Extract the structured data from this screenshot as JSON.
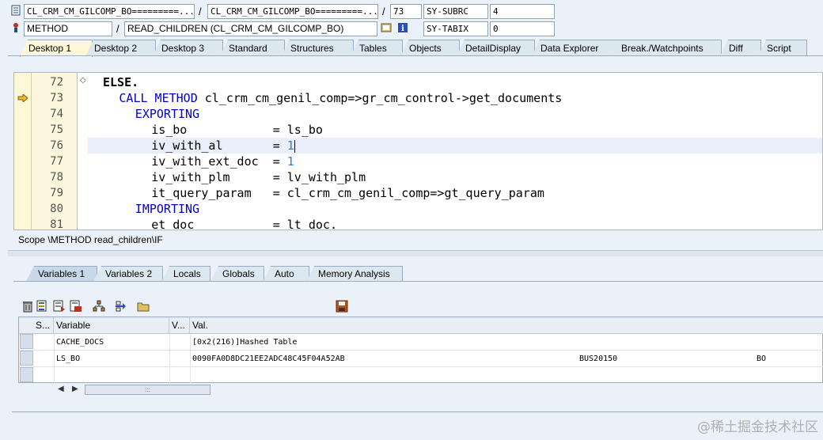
{
  "header": {
    "row1": {
      "program": "CL_CRM_CM_GILCOMP_BO=========...",
      "include": "CL_CRM_CM_GILCOMP_BO=========...",
      "line": "73",
      "sys_field1_label": "SY-SUBRC",
      "sys_field1_value": "4"
    },
    "row2": {
      "event_type": "METHOD",
      "event": "READ_CHILDREN (CL_CRM_CM_GILCOMP_BO)",
      "sys_field2_label": "SY-TABIX",
      "sys_field2_value": "0"
    },
    "separator": "/"
  },
  "tabs": [
    "Desktop 1",
    "Desktop 2",
    "Desktop 3",
    "Standard",
    "Structures",
    "Tables",
    "Objects",
    "DetailDisplay",
    "Data Explorer",
    "Break./Watchpoints",
    "Diff",
    "Script"
  ],
  "active_tab": "Desktop 1",
  "code": {
    "lines": [
      {
        "num": "72",
        "parts": [
          {
            "t": "ELSE.",
            "c": "kwb"
          }
        ],
        "indent": 0
      },
      {
        "num": "73",
        "parts": [
          {
            "t": "CALL METHOD",
            "c": "kw"
          },
          {
            "t": " cl_crm_cm_genil_comp=>gr_cm_control->get_documents",
            "c": ""
          }
        ],
        "indent": 2
      },
      {
        "num": "74",
        "parts": [
          {
            "t": "EXPORTING",
            "c": "kw"
          }
        ],
        "indent": 4
      },
      {
        "num": "75",
        "parts": [
          {
            "t": "is_bo            = ls_bo",
            "c": ""
          }
        ],
        "indent": 6
      },
      {
        "num": "76",
        "parts": [
          {
            "t": "iv_with_al       = ",
            "c": ""
          },
          {
            "t": "1",
            "c": "num"
          }
        ],
        "indent": 6
      },
      {
        "num": "77",
        "parts": [
          {
            "t": "iv_with_ext_doc  = ",
            "c": ""
          },
          {
            "t": "1",
            "c": "num"
          }
        ],
        "indent": 6
      },
      {
        "num": "78",
        "parts": [
          {
            "t": "iv_with_plm      = lv_with_plm",
            "c": ""
          }
        ],
        "indent": 6
      },
      {
        "num": "79",
        "parts": [
          {
            "t": "it_query_param   = cl_crm_cm_genil_comp=>gt_query_param",
            "c": ""
          }
        ],
        "indent": 6
      },
      {
        "num": "80",
        "parts": [
          {
            "t": "IMPORTING",
            "c": "kw"
          }
        ],
        "indent": 4
      },
      {
        "num": "81",
        "parts": [
          {
            "t": "et_doc           = lt_doc.",
            "c": ""
          }
        ],
        "indent": 6
      }
    ],
    "current_line": "73",
    "highlighted_line": "76"
  },
  "scope": "Scope \\METHOD read_children\\IF",
  "var_tabs": [
    "Variables 1",
    "Variables 2",
    "Locals",
    "Globals",
    "Auto",
    "Memory Analysis"
  ],
  "active_var_tab": "Variables 1",
  "grid": {
    "headers": [
      "S...",
      "Variable",
      "V...",
      "Val."
    ],
    "rows": [
      {
        "variable": "CACHE_DOCS",
        "value": "[0x2(216)]Hashed Table",
        "extra1": "",
        "extra2": ""
      },
      {
        "variable": "LS_BO",
        "value": "0090FA0D8DC21EE2ADC48C45F04A52AB",
        "extra1": "BUS20150",
        "extra2": "BO"
      }
    ],
    "scroll_grip": ":::"
  },
  "watermark": "@稀土掘金技术社区"
}
